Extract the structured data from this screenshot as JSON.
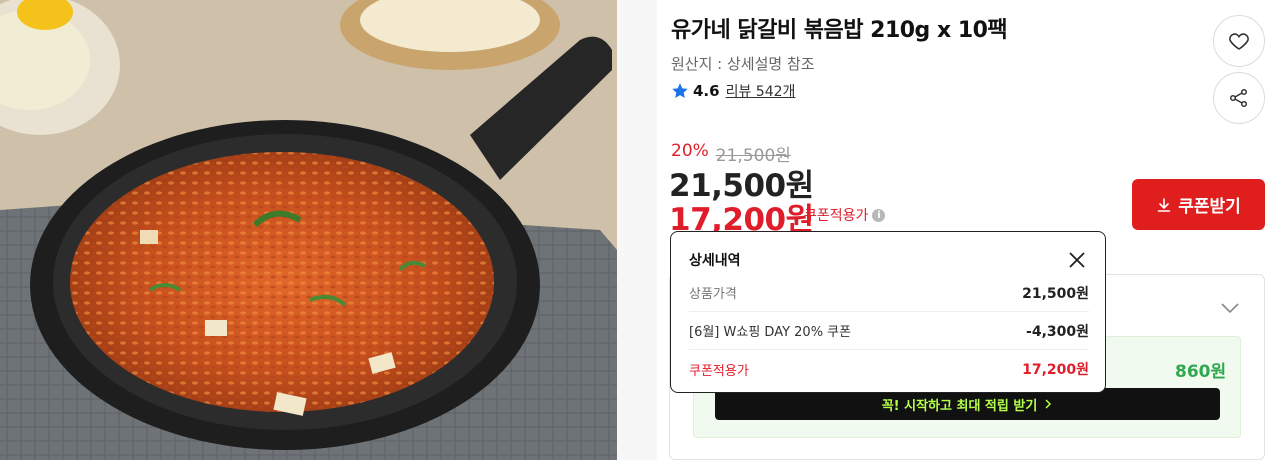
{
  "product": {
    "title": "유가네 닭갈비 볶음밥 210g x 10팩",
    "origin": "원산지 : 상세설명 참조",
    "rating": "4.6",
    "review_link": "리뷰 542개"
  },
  "price": {
    "discount_rate": "20%",
    "original_price": "21,500원",
    "sale_price": "21,500원",
    "coupon_price": "17,200원",
    "coupon_label": "쿠폰적용가",
    "info_icon": "i"
  },
  "actions": {
    "coupon_button": "쿠폰받기"
  },
  "popup": {
    "title": "상세내역",
    "rows": [
      {
        "label": "상품가격",
        "amount": "21,500원"
      },
      {
        "label": "[6월] W쇼핑 DAY 20% 쿠폰",
        "amount": "-4,300원"
      },
      {
        "label": "쿠폰적용가",
        "amount": "17,200원"
      }
    ]
  },
  "points": {
    "amount": "860원",
    "cta": "꼭! 시작하고 최대 적립 받기"
  },
  "icons": {
    "wishlist": "heart-icon",
    "share": "share-icon",
    "rating": "star-icon",
    "download": "download-icon",
    "close": "close-icon",
    "expand": "chevron-down-icon"
  },
  "colors": {
    "accent_red": "#e01e2b",
    "coupon_button": "#e01e1e",
    "point_green": "#2fa84f",
    "star_blue": "#1a73e8"
  }
}
